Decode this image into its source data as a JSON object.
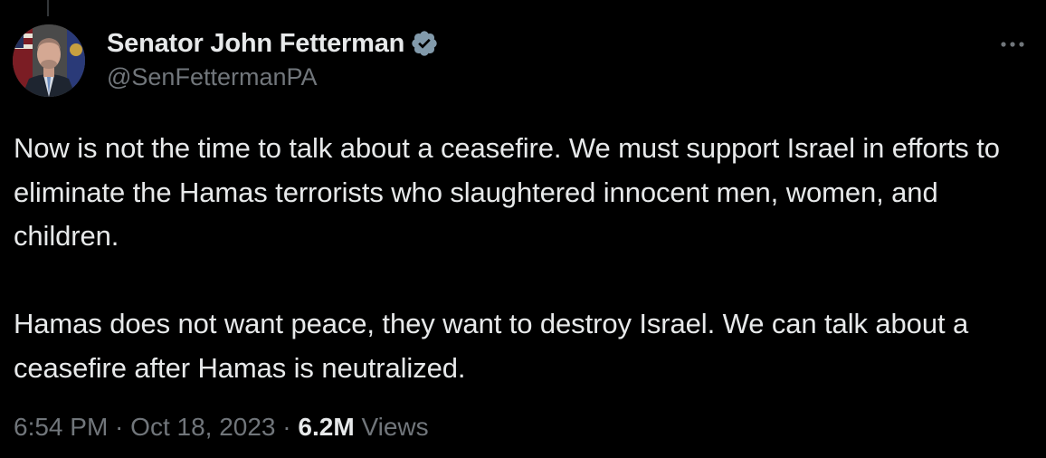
{
  "author": {
    "display_name": "Senator John Fetterman",
    "handle": "@SenFettermanPA",
    "verified_icon": "verified-badge-icon",
    "avatar_icon": "profile-photo"
  },
  "tweet": {
    "paragraphs": [
      "Now is not the time to talk about a ceasefire. We must support Israel in efforts to eliminate the Hamas terrorists who slaughtered innocent men, women, and children.",
      "Hamas does not want peace, they want to destroy Israel. We can talk about a ceasefire after Hamas is neutralized."
    ]
  },
  "meta": {
    "time": "6:54 PM",
    "separator": " · ",
    "date": "Oct 18, 2023",
    "views_count": "6.2M",
    "views_label": "Views"
  },
  "colors": {
    "background": "#000000",
    "text_primary": "#e7e9ea",
    "text_secondary": "#71767b",
    "verified_badge": "#829aab"
  },
  "menu": {
    "more_icon": "more-options-icon"
  }
}
